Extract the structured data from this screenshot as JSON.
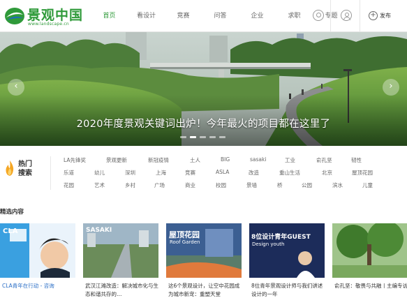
{
  "brand": {
    "name": "景观中国",
    "url_text": "www.landscape.cn",
    "accent": "#2f9a3a"
  },
  "nav": {
    "items": [
      {
        "label": "首页",
        "active": true
      },
      {
        "label": "看设计"
      },
      {
        "label": "竞赛"
      },
      {
        "label": "问答"
      },
      {
        "label": "企业"
      },
      {
        "label": "求职"
      },
      {
        "label": "专题"
      }
    ]
  },
  "header_actions": {
    "search_icon": "search-icon",
    "user_icon": "user-icon",
    "publish_label": "发布"
  },
  "hero": {
    "caption": "2020年度景观关键词出炉！今年最火的项目都在这里了",
    "prev_icon": "chevron-left-icon",
    "next_icon": "chevron-right-icon",
    "slide_count": 5,
    "active_slide": 1
  },
  "hot_search": {
    "title_line1": "热门",
    "title_line2": "搜索",
    "rows": [
      [
        "LA先锋奖",
        "景观更新",
        "新冠疫情",
        "土人",
        "BIG",
        "sasaki",
        "工业",
        "俞孔坚",
        "韧性"
      ],
      [
        "乐道",
        "幼儿",
        "深圳",
        "上海",
        "竞赛",
        "ASLA",
        "改造",
        "重山生活",
        "北京",
        "屋顶花园"
      ],
      [
        "花园",
        "艺术",
        "乡村",
        "广场",
        "商业",
        "校园",
        "景墙",
        "桥",
        "公园",
        "滨水",
        "儿童"
      ]
    ]
  },
  "featured": {
    "title": "精选内容",
    "cards": [
      {
        "title": "CLA青年在行动 - 咨询",
        "thumb_text": "CLA",
        "highlight": true
      },
      {
        "title": "武汉江滩改造：解决城市化与生态和谐共存的…",
        "thumb_text": "SASAKI"
      },
      {
        "title": "这6个景观设计，让空中花园成为城市新宠：重塑天堂",
        "thumb_text": "屋顶花园",
        "thumb_sub": "Roof Garden"
      },
      {
        "title": "8位青年景观设计师与我们讲述设计的一年",
        "thumb_text": "8位设计青年GUEST",
        "thumb_sub": "Design youth"
      },
      {
        "title": "俞孔坚：敬畏与共融丨主编专访",
        "thumb_text": ""
      }
    ]
  }
}
